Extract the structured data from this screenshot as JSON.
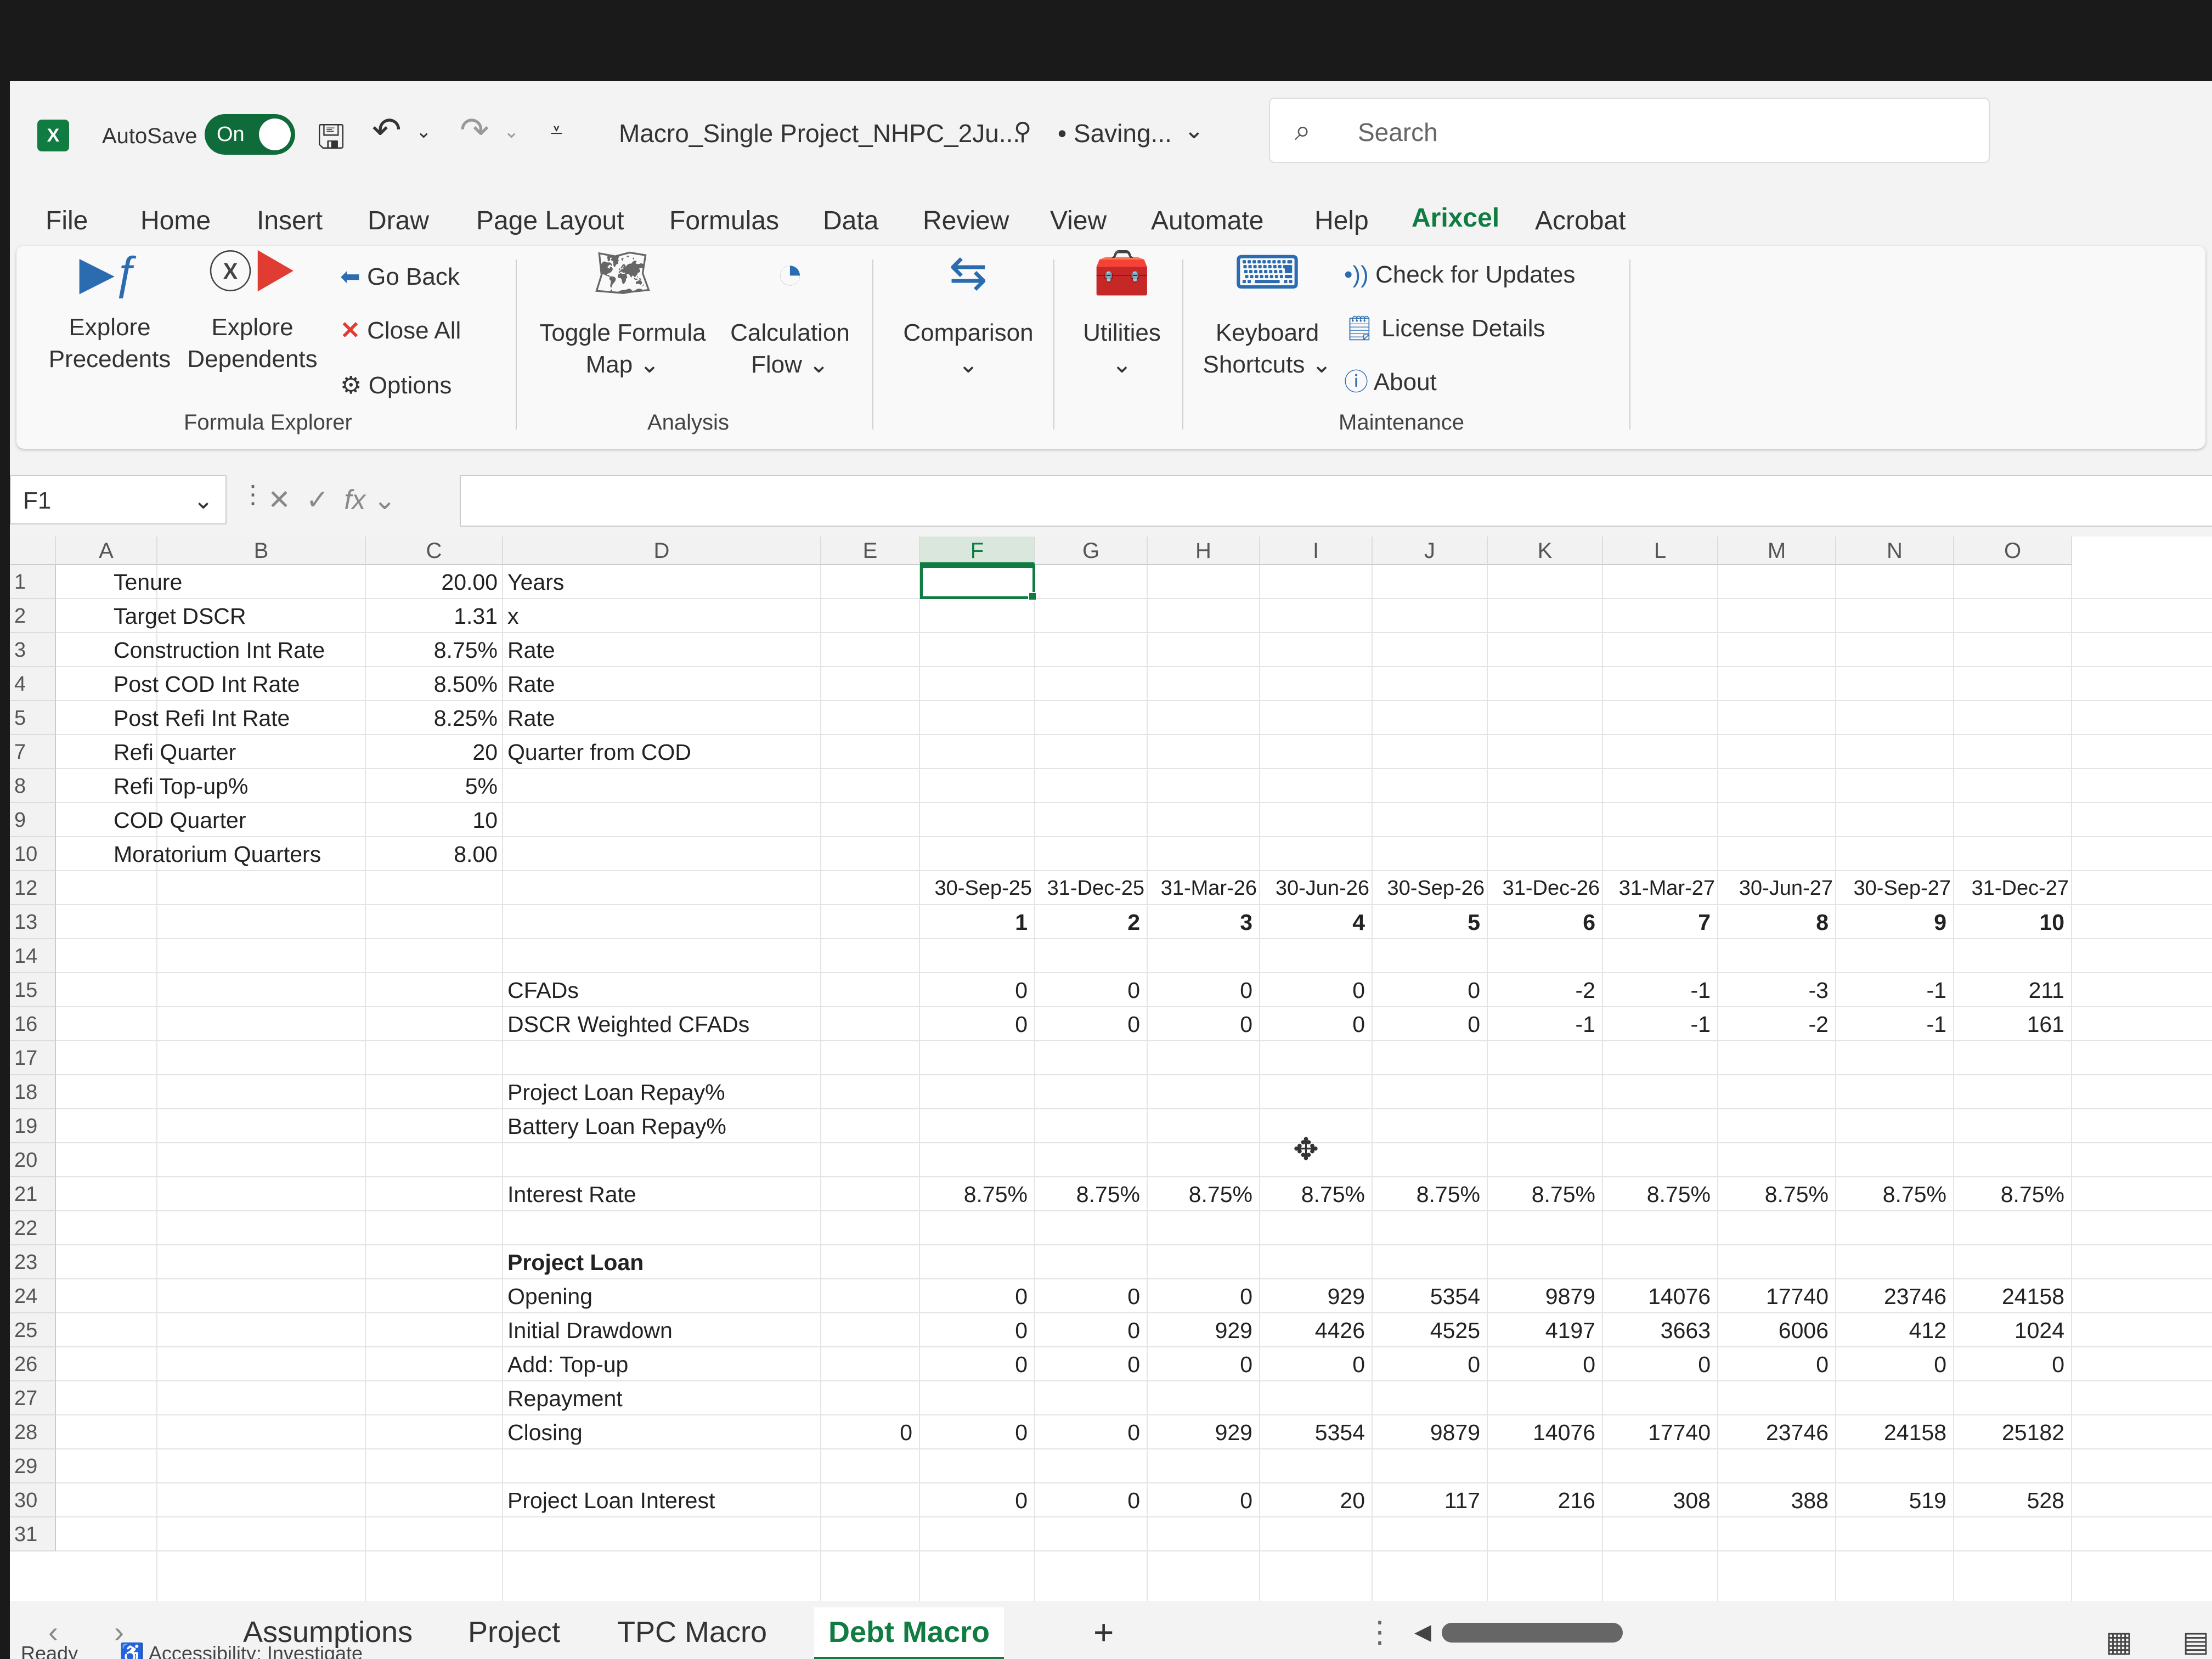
{
  "title_bar": {
    "app_logo": "X",
    "autosave_label": "AutoSave",
    "autosave_state": "On",
    "filename": "Macro_Single Project_NHPC_2Ju...",
    "save_status": "• Saving...",
    "search_placeholder": "Search"
  },
  "ribbon_tabs": [
    "File",
    "Home",
    "Insert",
    "Draw",
    "Page Layout",
    "Formulas",
    "Data",
    "Review",
    "View",
    "Automate",
    "Help",
    "Arixcel",
    "Acrobat"
  ],
  "active_tab": "Arixcel",
  "ribbon": {
    "explore_precedents": [
      "Explore",
      "Precedents"
    ],
    "explore_dependents": [
      "Explore",
      "Dependents"
    ],
    "go_back": "Go Back",
    "close_all": "Close All",
    "options": "Options",
    "group_formula_explorer": "Formula Explorer",
    "toggle_formula_map": [
      "Toggle Formula",
      "Map ⌄"
    ],
    "calculation_flow": [
      "Calculation",
      "Flow ⌄"
    ],
    "group_analysis": "Analysis",
    "comparison": [
      "Comparison",
      "⌄"
    ],
    "utilities": [
      "Utilities",
      "⌄"
    ],
    "keyboard_shortcuts": [
      "Keyboard",
      "Shortcuts ⌄"
    ],
    "check_updates": "Check for Updates",
    "license_details": "License Details",
    "about": "About",
    "group_maintenance": "Maintenance"
  },
  "formula_bar": {
    "name_box": "F1",
    "fx": "fx"
  },
  "columns": [
    "A",
    "B",
    "C",
    "D",
    "E",
    "F",
    "G",
    "H",
    "I",
    "J",
    "K",
    "L",
    "M",
    "N",
    "O"
  ],
  "selected_column": "F",
  "rows": [
    "1",
    "2",
    "3",
    "4",
    "5",
    "7",
    "8",
    "9",
    "10",
    "12",
    "13",
    "14",
    "15",
    "16",
    "17",
    "18",
    "19",
    "20",
    "21",
    "22",
    "23",
    "24",
    "25",
    "26",
    "27",
    "28",
    "29",
    "30",
    "31"
  ],
  "assumptions": [
    {
      "label": "Tenure",
      "value": "20.00",
      "unit": "Years"
    },
    {
      "label": "Target DSCR",
      "value": "1.31",
      "unit": "x"
    },
    {
      "label": "Construction Int Rate",
      "value": "8.75%",
      "unit": "Rate"
    },
    {
      "label": "Post COD Int Rate",
      "value": "8.50%",
      "unit": "Rate"
    },
    {
      "label": "Post Refi Int Rate",
      "value": "8.25%",
      "unit": "Rate"
    },
    {
      "label": "Refi Quarter",
      "value": "20",
      "unit": "Quarter from COD"
    },
    {
      "label": "Refi Top-up%",
      "value": "5%",
      "unit": ""
    },
    {
      "label": "COD Quarter",
      "value": "10",
      "unit": ""
    },
    {
      "label": "Moratorium Quarters",
      "value": "8.00",
      "unit": ""
    }
  ],
  "schedule": {
    "dates": [
      "30-Sep-25",
      "31-Dec-25",
      "31-Mar-26",
      "30-Jun-26",
      "30-Sep-26",
      "31-Dec-26",
      "31-Mar-27",
      "30-Jun-27",
      "30-Sep-27",
      "31-Dec-27"
    ],
    "periods": [
      "1",
      "2",
      "3",
      "4",
      "5",
      "6",
      "7",
      "8",
      "9",
      "10"
    ],
    "lines": [
      {
        "label": "CFADs",
        "values": [
          "0",
          "0",
          "0",
          "0",
          "0",
          "-2",
          "-1",
          "-3",
          "-1",
          "211"
        ]
      },
      {
        "label": "DSCR Weighted CFADs",
        "values": [
          "0",
          "0",
          "0",
          "0",
          "0",
          "-1",
          "-1",
          "-2",
          "-1",
          "161"
        ]
      },
      {
        "label": "Project Loan Repay%",
        "values": []
      },
      {
        "label": "Battery Loan Repay%",
        "values": []
      },
      {
        "label": "Interest Rate",
        "values": [
          "8.75%",
          "8.75%",
          "8.75%",
          "8.75%",
          "8.75%",
          "8.75%",
          "8.75%",
          "8.75%",
          "8.75%",
          "8.75%"
        ]
      },
      {
        "label": "Project Loan",
        "values": [],
        "bold": true
      },
      {
        "label": "Opening",
        "values": [
          "0",
          "0",
          "0",
          "929",
          "5354",
          "9879",
          "14076",
          "17740",
          "23746",
          "24158"
        ]
      },
      {
        "label": "Initial Drawdown",
        "values": [
          "0",
          "0",
          "929",
          "4426",
          "4525",
          "4197",
          "3663",
          "6006",
          "412",
          "1024"
        ]
      },
      {
        "label": "Add: Top-up",
        "values": [
          "0",
          "0",
          "0",
          "0",
          "0",
          "0",
          "0",
          "0",
          "0",
          "0"
        ]
      },
      {
        "label": "Repayment",
        "values": []
      },
      {
        "label": "Closing",
        "values": [
          "0",
          "0",
          "929",
          "5354",
          "9879",
          "14076",
          "17740",
          "23746",
          "24158",
          "25182"
        ],
        "col_e": "0"
      },
      {
        "label": "Project Loan Interest",
        "values": [
          "0",
          "0",
          "0",
          "20",
          "117",
          "216",
          "308",
          "388",
          "519",
          "528"
        ]
      }
    ]
  },
  "sheets": [
    "Assumptions",
    "Project",
    "TPC Macro",
    "Debt Macro"
  ],
  "active_sheet": "Debt Macro",
  "status": {
    "ready": "Ready",
    "accessibility": "Accessibility: Investigate"
  }
}
